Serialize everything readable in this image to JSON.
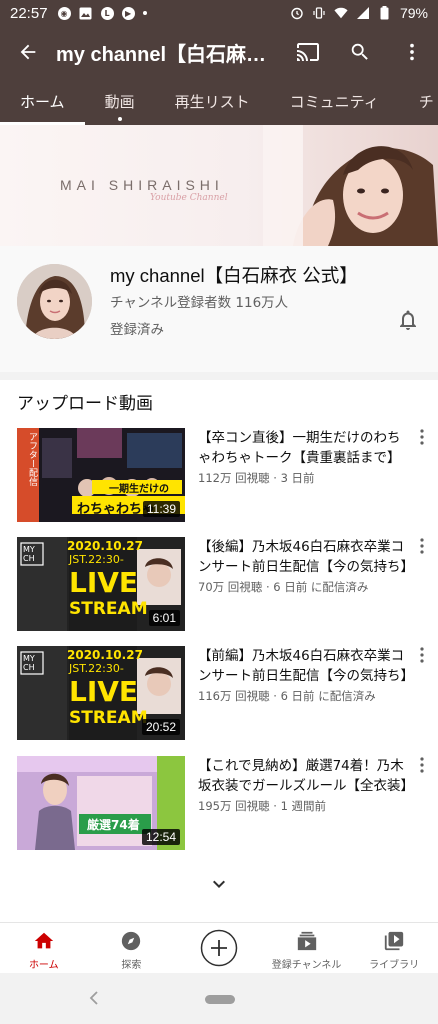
{
  "status_bar": {
    "time": "22:57",
    "battery": "79%",
    "left_icons": [
      "chrome-icon",
      "photo-icon",
      "line-icon",
      "play-icon",
      "dot-icon"
    ],
    "right_icons": [
      "alarm-icon",
      "vibrate-icon",
      "wifi-icon",
      "signal-icon",
      "battery-icon"
    ]
  },
  "app_bar": {
    "title": "my channel【白石麻衣 公式】",
    "actions": [
      "cast-icon",
      "search-icon",
      "more-vert-icon"
    ]
  },
  "tabs": [
    {
      "label": "ホーム",
      "active": true
    },
    {
      "label": "動画",
      "active": false,
      "new_dot": true
    },
    {
      "label": "再生リスト",
      "active": false
    },
    {
      "label": "コミュニティ",
      "active": false
    },
    {
      "label": "チ",
      "active": false
    }
  ],
  "banner": {
    "name": "MAI SHIRAISHI",
    "sub": "Youtube Channel"
  },
  "channel": {
    "name": "my channel【白石麻衣 公式】",
    "subscribers": "チャンネル登録者数 116万人",
    "status": "登録済み"
  },
  "section": {
    "title": "アップロード動画"
  },
  "videos": [
    {
      "title": "【卒コン直後】一期生だけのわちゃわちゃトーク【貴重裏話まで】",
      "meta": "112万 回視聴 · 3 日前",
      "duration": "11:39",
      "thumb_text_1": "アフター配信",
      "thumb_text_2": "一期生だけの",
      "thumb_text_3": "わちゃわちゃ"
    },
    {
      "title": "【後編】乃木坂46白石麻衣卒業コンサート前日生配信【今の気持ち】",
      "meta": "70万 回視聴 · 6 日前 に配信済み",
      "duration": "6:01",
      "thumb_date": "2020.10.27",
      "thumb_time": "JST.22:30-",
      "thumb_live_1": "LIVE",
      "thumb_live_2": "STREAM",
      "thumb_logo": "MY CH"
    },
    {
      "title": "【前編】乃木坂46白石麻衣卒業コンサート前日生配信【今の気持ち】",
      "meta": "116万 回視聴 · 6 日前 に配信済み",
      "duration": "20:52",
      "thumb_date": "2020.10.27",
      "thumb_time": "JST.22:30-",
      "thumb_live_1": "LIVE",
      "thumb_live_2": "STREAM",
      "thumb_logo": "MY CH"
    },
    {
      "title": "【これで見納め】厳選74着！乃木坂衣装でガールズルール【全衣装】",
      "meta": "195万 回視聴 · 1 週間前",
      "duration": "12:54",
      "thumb_text_1": "厳選74着"
    }
  ],
  "bottom_nav": [
    {
      "label": "ホーム",
      "icon": "home-icon",
      "active": true
    },
    {
      "label": "探索",
      "icon": "explore-icon",
      "active": false
    },
    {
      "label": "",
      "icon": "create-icon",
      "active": false
    },
    {
      "label": "登録チャンネル",
      "icon": "subscriptions-icon",
      "active": false
    },
    {
      "label": "ライブラリ",
      "icon": "library-icon",
      "active": false
    }
  ],
  "colors": {
    "header_bg": "#4e3f3c",
    "accent_red": "#cc0000",
    "meta_text": "#606060"
  }
}
